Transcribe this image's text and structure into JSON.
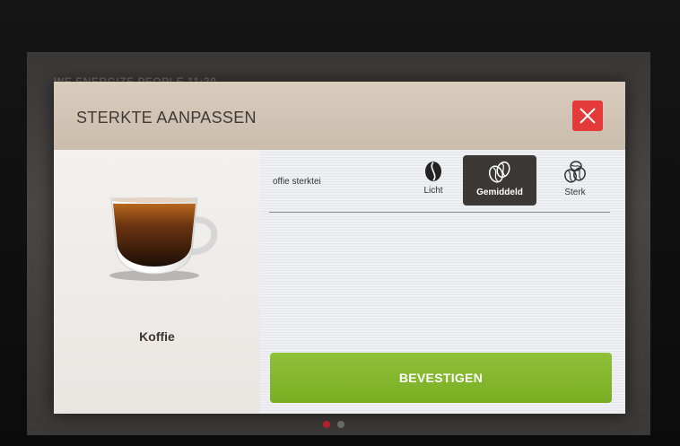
{
  "background": {
    "header_text": "WE ENERGIZE PEOPLE      11:30"
  },
  "dialog": {
    "title": "STERKTE AANPASSEN",
    "close_icon": "close-x-icon",
    "product": {
      "name": "Koffie",
      "image_icon": "coffee-cup-icon"
    },
    "strength": {
      "label": "offie sterktei",
      "options": [
        {
          "label": "Licht",
          "icon": "single-bean-icon",
          "selected": false
        },
        {
          "label": "Gemiddeld",
          "icon": "double-bean-icon",
          "selected": true
        },
        {
          "label": "Sterk",
          "icon": "triple-bean-icon",
          "selected": false
        }
      ]
    },
    "confirm_label": "BEVESTIGEN"
  },
  "pager": {
    "pages": 2,
    "active": 1
  },
  "colors": {
    "close": "#e53a3a",
    "confirm": "#82b72c",
    "selected_option": "#3c3835",
    "active_dot": "#b0202a"
  }
}
